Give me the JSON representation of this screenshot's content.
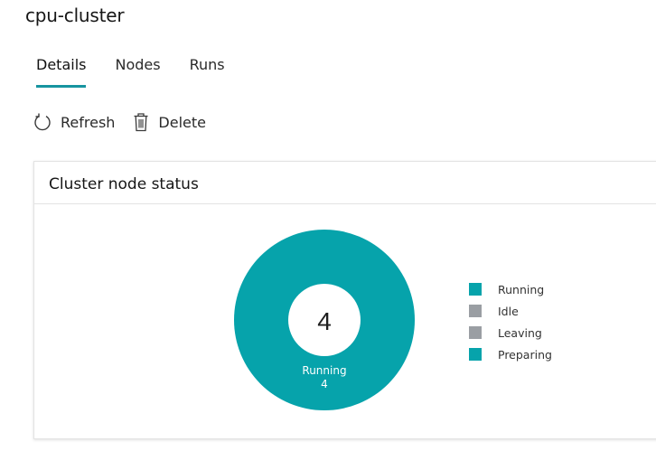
{
  "page": {
    "title": "cpu-cluster"
  },
  "tabs": [
    {
      "label": "Details",
      "active": true
    },
    {
      "label": "Nodes",
      "active": false
    },
    {
      "label": "Runs",
      "active": false
    }
  ],
  "toolbar": {
    "refresh_label": "Refresh",
    "refresh_icon": "refresh-icon",
    "delete_label": "Delete",
    "delete_icon": "trash-icon"
  },
  "card": {
    "title": "Cluster node status"
  },
  "colors": {
    "accent": "#1794a0",
    "running": "#06a3ab",
    "idle": "#9a9ea3",
    "leaving": "#9a9ea3",
    "preparing": "#06a3ab"
  },
  "chart_data": {
    "type": "pie",
    "center_value": "4",
    "categories": [
      "Running",
      "Idle",
      "Leaving",
      "Preparing"
    ],
    "values": [
      4,
      0,
      0,
      0
    ],
    "slice_label": {
      "name": "Running",
      "value": "4"
    },
    "legend_placement": "right"
  }
}
